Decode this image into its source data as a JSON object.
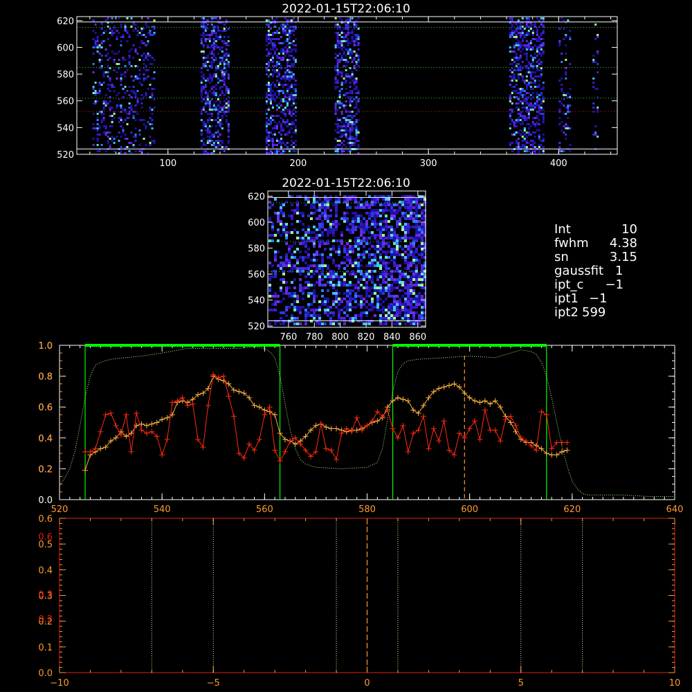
{
  "colors": {
    "background": "#000000",
    "axis_white": "#ffffff",
    "axis_orange": "#ff9a30",
    "axis_red": "#e02010",
    "green": "#00ff00",
    "orange_series": "#ffb040",
    "red_series": "#ff2a10",
    "green_dotted": "#b0ff90"
  },
  "fit_info": {
    "rows": [
      {
        "label": "Int",
        "value": "10"
      },
      {
        "label": "fwhm",
        "value": "4.38"
      },
      {
        "label": "sn",
        "value": "3.15"
      },
      {
        "label": "gaussfit",
        "value": "1"
      },
      {
        "label": "ipt_c",
        "value": "−1"
      },
      {
        "label": "ipt1",
        "value": "−1"
      },
      {
        "label": "ipt2",
        "value": "599"
      }
    ]
  },
  "chart_data": [
    {
      "id": "overview-image",
      "type": "heatmap",
      "title": "2022-01-15T22:06:10",
      "xlim": [
        30,
        445
      ],
      "ylim": [
        520,
        623
      ],
      "xticks": [
        100,
        200,
        300,
        400
      ],
      "yticks": [
        520,
        540,
        560,
        580,
        600,
        620
      ],
      "column_bands": [
        [
          42,
          58
        ],
        [
          60,
          90
        ],
        [
          125,
          146
        ],
        [
          175,
          198
        ],
        [
          228,
          246
        ],
        [
          362,
          388
        ],
        [
          400,
          408
        ],
        [
          426,
          430
        ]
      ],
      "white_lines_y": [
        524,
        619
      ],
      "green_dotted_y": [
        562,
        585,
        615
      ],
      "red_dotted_y": [
        552
      ]
    },
    {
      "id": "zoom-image",
      "type": "heatmap",
      "title": "2022-01-15T22:06:10",
      "xlim": [
        744,
        866
      ],
      "ylim": [
        519,
        624
      ],
      "xticks": [
        760,
        780,
        800,
        820,
        840,
        860
      ],
      "yticks": [
        520,
        540,
        560,
        580,
        600,
        620
      ],
      "white_lines_y": [
        524,
        619
      ],
      "green_dotted_y": [
        562,
        585,
        615
      ]
    },
    {
      "id": "spectrum-profile",
      "type": "line",
      "xlim": [
        520,
        640
      ],
      "ylim": [
        0,
        1.0
      ],
      "xticks": [
        520,
        540,
        560,
        580,
        600,
        620,
        640
      ],
      "yticks": [
        0.0,
        0.2,
        0.4,
        0.6,
        0.8,
        1.0
      ],
      "ytick_labels_white": [
        "0.0",
        "0.2",
        "0.4",
        "0.6",
        "0.8",
        "1.0"
      ],
      "ytick_labels_orange": [
        "0.2",
        "0.4",
        "0.6",
        "0.8",
        "1.0"
      ],
      "green_windows": [
        [
          525,
          563
        ],
        [
          585,
          615
        ]
      ],
      "marker_x": 599,
      "series": [
        {
          "color": "orange",
          "marker": "plus",
          "x": [
            525,
            526,
            527,
            528,
            529,
            530,
            531,
            532,
            533,
            534,
            535,
            536,
            537,
            538,
            539,
            540,
            541,
            542,
            543,
            544,
            545,
            546,
            547,
            548,
            549,
            550,
            551,
            552,
            553,
            554,
            555,
            556,
            557,
            558,
            559,
            560,
            561,
            562,
            563,
            564,
            565,
            566,
            567,
            568,
            569,
            570,
            571,
            572,
            573,
            574,
            575,
            576,
            577,
            578,
            579,
            580,
            581,
            582,
            583,
            584,
            585,
            586,
            587,
            588,
            589,
            590,
            591,
            592,
            593,
            594,
            595,
            596,
            597,
            598,
            599,
            600,
            601,
            602,
            603,
            604,
            605,
            606,
            607,
            608,
            609,
            610,
            611,
            612,
            613,
            614,
            615,
            616,
            617,
            618,
            619
          ],
          "y": [
            0.19,
            0.29,
            0.31,
            0.33,
            0.34,
            0.38,
            0.4,
            0.44,
            0.41,
            0.43,
            0.48,
            0.49,
            0.48,
            0.49,
            0.5,
            0.52,
            0.53,
            0.55,
            0.63,
            0.64,
            0.63,
            0.65,
            0.68,
            0.69,
            0.72,
            0.8,
            0.78,
            0.77,
            0.75,
            0.71,
            0.7,
            0.69,
            0.66,
            0.61,
            0.6,
            0.58,
            0.57,
            0.55,
            0.43,
            0.39,
            0.38,
            0.36,
            0.38,
            0.41,
            0.45,
            0.48,
            0.49,
            0.47,
            0.46,
            0.46,
            0.45,
            0.44,
            0.45,
            0.45,
            0.46,
            0.48,
            0.5,
            0.51,
            0.53,
            0.6,
            0.64,
            0.66,
            0.65,
            0.64,
            0.58,
            0.56,
            0.61,
            0.66,
            0.7,
            0.72,
            0.73,
            0.74,
            0.75,
            0.73,
            0.69,
            0.66,
            0.64,
            0.63,
            0.64,
            0.62,
            0.64,
            0.6,
            0.54,
            0.5,
            0.44,
            0.39,
            0.37,
            0.37,
            0.35,
            0.33,
            0.3,
            0.29,
            0.29,
            0.31,
            0.32
          ]
        },
        {
          "color": "red",
          "marker": "plus",
          "x": [
            525,
            526,
            527,
            528,
            529,
            530,
            531,
            532,
            533,
            534,
            535,
            536,
            537,
            538,
            539,
            540,
            541,
            542,
            543,
            544,
            545,
            546,
            547,
            548,
            549,
            550,
            551,
            552,
            553,
            554,
            555,
            556,
            557,
            558,
            559,
            560,
            561,
            562,
            563,
            564,
            565,
            566,
            567,
            568,
            569,
            570,
            571,
            572,
            573,
            574,
            575,
            576,
            577,
            578,
            579,
            580,
            581,
            582,
            583,
            584,
            585,
            586,
            587,
            588,
            589,
            590,
            591,
            592,
            593,
            594,
            595,
            596,
            597,
            598,
            599,
            600,
            601,
            602,
            603,
            604,
            605,
            606,
            607,
            608,
            609,
            610,
            611,
            612,
            613,
            614,
            615,
            616,
            617,
            618,
            619
          ],
          "y": [
            0.31,
            0.31,
            0.33,
            0.44,
            0.55,
            0.56,
            0.48,
            0.42,
            0.55,
            0.31,
            0.56,
            0.45,
            0.43,
            0.44,
            0.41,
            0.29,
            0.39,
            0.63,
            0.64,
            0.66,
            0.61,
            0.62,
            0.39,
            0.34,
            0.61,
            0.81,
            0.79,
            0.8,
            0.67,
            0.54,
            0.3,
            0.27,
            0.36,
            0.32,
            0.39,
            0.55,
            0.6,
            0.32,
            0.25,
            0.31,
            0.38,
            0.4,
            0.36,
            0.32,
            0.28,
            0.31,
            0.49,
            0.33,
            0.32,
            0.26,
            0.43,
            0.46,
            0.44,
            0.53,
            0.45,
            0.48,
            0.51,
            0.57,
            0.54,
            0.58,
            0.46,
            0.4,
            0.48,
            0.31,
            0.43,
            0.45,
            0.54,
            0.33,
            0.46,
            0.38,
            0.51,
            0.32,
            0.29,
            0.43,
            0.4,
            0.46,
            0.51,
            0.39,
            0.58,
            0.45,
            0.45,
            0.38,
            0.52,
            0.54,
            0.48,
            0.4,
            0.38,
            0.35,
            0.32,
            0.57,
            0.55,
            0.33,
            0.37,
            0.37,
            0.37
          ]
        },
        {
          "color": "green",
          "style": "dotted",
          "x": [
            520,
            521,
            522,
            523,
            524,
            525,
            526,
            527,
            528,
            529,
            530,
            533,
            536,
            540,
            545,
            550,
            555,
            558,
            560,
            561,
            562,
            563,
            564,
            565,
            566,
            567,
            568,
            570,
            575,
            580,
            582,
            583,
            584,
            585,
            586,
            587,
            588,
            590,
            595,
            600,
            605,
            610,
            612,
            613,
            614,
            615,
            616,
            617,
            618,
            619,
            620,
            621,
            622,
            623,
            624,
            625,
            630,
            635,
            640
          ],
          "y": [
            0.09,
            0.14,
            0.2,
            0.31,
            0.48,
            0.66,
            0.8,
            0.87,
            0.89,
            0.9,
            0.91,
            0.92,
            0.93,
            0.95,
            0.98,
            0.98,
            0.98,
            0.99,
            0.98,
            0.96,
            0.92,
            0.8,
            0.62,
            0.45,
            0.33,
            0.26,
            0.23,
            0.21,
            0.2,
            0.21,
            0.24,
            0.33,
            0.52,
            0.7,
            0.83,
            0.88,
            0.9,
            0.91,
            0.92,
            0.93,
            0.92,
            0.97,
            0.96,
            0.94,
            0.89,
            0.8,
            0.66,
            0.5,
            0.35,
            0.22,
            0.12,
            0.07,
            0.04,
            0.03,
            0.03,
            0.03,
            0.03,
            0.02,
            0.02
          ]
        }
      ]
    },
    {
      "id": "lag-plot",
      "type": "line",
      "xlim": [
        -10,
        10
      ],
      "ylim": [
        0,
        0.6
      ],
      "xticks": [
        -10,
        -5,
        0,
        5,
        10
      ],
      "yticks_orange": [
        "0.0",
        "0.1",
        "0.2",
        "0.3",
        "0.4",
        "0.5",
        "0.6"
      ],
      "yticks_red": [
        "0.2",
        "0.3",
        "0.6"
      ],
      "vertical_dotted_x": [
        -7,
        -5,
        -1,
        1,
        5,
        7
      ],
      "marker_x": 0
    }
  ]
}
